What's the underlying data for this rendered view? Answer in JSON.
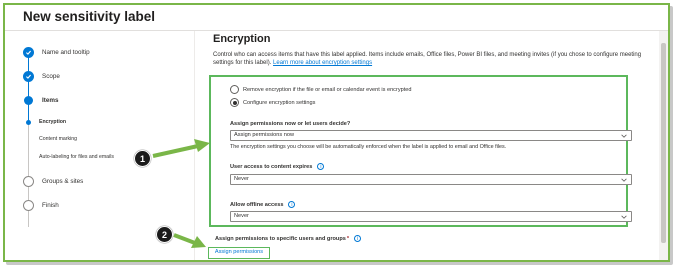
{
  "header": {
    "title": "New sensitivity label"
  },
  "sidebar": {
    "steps": [
      {
        "label": "Name and tooltip",
        "state": "done"
      },
      {
        "label": "Scope",
        "state": "done"
      },
      {
        "label": "Items",
        "state": "current"
      },
      {
        "label": "Groups & sites",
        "state": "todo"
      },
      {
        "label": "Finish",
        "state": "todo"
      }
    ],
    "substeps": [
      {
        "label": "Encryption",
        "active": true
      },
      {
        "label": "Content marking",
        "active": false
      },
      {
        "label": "Auto-labeling for files and emails",
        "active": false
      }
    ]
  },
  "main": {
    "title": "Encryption",
    "description": "Control who can access items that have this label applied. Items include emails, Office files, Power BI files, and meeting invites (if you chose to configure meeting settings for this label).",
    "description_link": "Learn more about encryption settings",
    "radio_remove": "Remove encryption if the file or email or calendar event is encrypted",
    "radio_configure": "Configure encryption settings",
    "assign_question": "Assign permissions now or let users decide?",
    "assign_value": "Assign permissions now",
    "assign_helper": "The encryption settings you choose will be automatically enforced when the label is applied to email and Office files.",
    "expires_label": "User access to content expires",
    "expires_value": "Never",
    "offline_label": "Allow offline access",
    "offline_value": "Never",
    "specific_label": "Assign permissions to specific users and groups",
    "required_mark": "*",
    "assign_button": "Assign permissions"
  },
  "callouts": {
    "one": "1",
    "two": "2"
  },
  "colors": {
    "accent": "#0078d4",
    "highlight": "#5cb85c",
    "frame": "#7ab648"
  },
  "icons": {
    "info": "info-icon",
    "chevron": "chevron-down-icon",
    "check": "check-icon"
  }
}
